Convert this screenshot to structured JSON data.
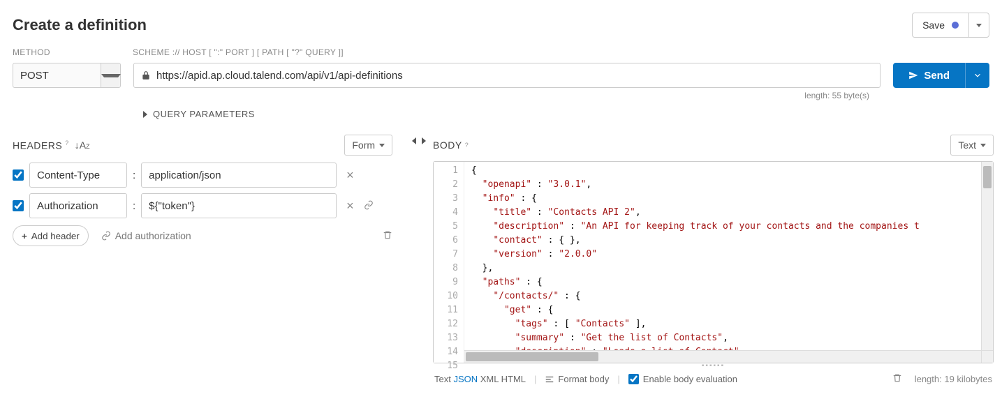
{
  "title": "Create a definition",
  "save": {
    "label": "Save"
  },
  "labels": {
    "method": "METHOD",
    "url": "SCHEME :// HOST [ \":\" PORT ] [ PATH [ \"?\" QUERY ]]"
  },
  "method": "POST",
  "url": "https://apid.ap.cloud.talend.com/api/v1/api-definitions",
  "send": "Send",
  "lengthInfo": "length: 55 byte(s)",
  "queryParams": "QUERY PARAMETERS",
  "headersSection": {
    "title": "HEADERS",
    "mode": "Form"
  },
  "headers": [
    {
      "enabled": true,
      "name": "Content-Type",
      "value": "application/json",
      "hasLink": false
    },
    {
      "enabled": true,
      "name": "Authorization",
      "value": "${\"token\"}",
      "hasLink": true
    }
  ],
  "addHeader": "Add header",
  "addAuth": "Add authorization",
  "bodySection": {
    "title": "BODY",
    "mode": "Text"
  },
  "bodyLineCount": 15,
  "bodyCodeLines": [
    {
      "plain": "{",
      "tokens": [
        {
          "t": "p",
          "v": "{"
        }
      ]
    },
    {
      "plain": "  \"openapi\" : \"3.0.1\",",
      "tokens": [
        {
          "t": "w",
          "v": "  "
        },
        {
          "t": "k",
          "v": "\"openapi\""
        },
        {
          "t": "p",
          "v": " : "
        },
        {
          "t": "s",
          "v": "\"3.0.1\""
        },
        {
          "t": "p",
          "v": ","
        }
      ]
    },
    {
      "plain": "  \"info\" : {",
      "tokens": [
        {
          "t": "w",
          "v": "  "
        },
        {
          "t": "k",
          "v": "\"info\""
        },
        {
          "t": "p",
          "v": " : {"
        }
      ]
    },
    {
      "plain": "    \"title\" : \"Contacts API 2\",",
      "tokens": [
        {
          "t": "w",
          "v": "    "
        },
        {
          "t": "k",
          "v": "\"title\""
        },
        {
          "t": "p",
          "v": " : "
        },
        {
          "t": "s",
          "v": "\"Contacts API 2\""
        },
        {
          "t": "p",
          "v": ","
        }
      ]
    },
    {
      "plain": "    \"description\" : \"An API for keeping track of your contacts and the companies t",
      "tokens": [
        {
          "t": "w",
          "v": "    "
        },
        {
          "t": "k",
          "v": "\"description\""
        },
        {
          "t": "p",
          "v": " : "
        },
        {
          "t": "s",
          "v": "\"An API for keeping track of your contacts and the companies t"
        }
      ]
    },
    {
      "plain": "    \"contact\" : { },",
      "tokens": [
        {
          "t": "w",
          "v": "    "
        },
        {
          "t": "k",
          "v": "\"contact\""
        },
        {
          "t": "p",
          "v": " : { },"
        }
      ]
    },
    {
      "plain": "    \"version\" : \"2.0.0\"",
      "tokens": [
        {
          "t": "w",
          "v": "    "
        },
        {
          "t": "k",
          "v": "\"version\""
        },
        {
          "t": "p",
          "v": " : "
        },
        {
          "t": "s",
          "v": "\"2.0.0\""
        }
      ]
    },
    {
      "plain": "  },",
      "tokens": [
        {
          "t": "w",
          "v": "  "
        },
        {
          "t": "p",
          "v": "},"
        }
      ]
    },
    {
      "plain": "  \"paths\" : {",
      "tokens": [
        {
          "t": "w",
          "v": "  "
        },
        {
          "t": "k",
          "v": "\"paths\""
        },
        {
          "t": "p",
          "v": " : {"
        }
      ]
    },
    {
      "plain": "    \"/contacts/\" : {",
      "tokens": [
        {
          "t": "w",
          "v": "    "
        },
        {
          "t": "k",
          "v": "\"/contacts/\""
        },
        {
          "t": "p",
          "v": " : {"
        }
      ]
    },
    {
      "plain": "      \"get\" : {",
      "tokens": [
        {
          "t": "w",
          "v": "      "
        },
        {
          "t": "k",
          "v": "\"get\""
        },
        {
          "t": "p",
          "v": " : {"
        }
      ]
    },
    {
      "plain": "        \"tags\" : [ \"Contacts\" ],",
      "tokens": [
        {
          "t": "w",
          "v": "        "
        },
        {
          "t": "k",
          "v": "\"tags\""
        },
        {
          "t": "p",
          "v": " : [ "
        },
        {
          "t": "s",
          "v": "\"Contacts\""
        },
        {
          "t": "p",
          "v": " ],"
        }
      ]
    },
    {
      "plain": "        \"summary\" : \"Get the list of Contacts\",",
      "tokens": [
        {
          "t": "w",
          "v": "        "
        },
        {
          "t": "k",
          "v": "\"summary\""
        },
        {
          "t": "p",
          "v": " : "
        },
        {
          "t": "s",
          "v": "\"Get the list of Contacts\""
        },
        {
          "t": "p",
          "v": ","
        }
      ]
    },
    {
      "plain": "        \"description\" : \"Loads a list of Contact\",",
      "tokens": [
        {
          "t": "w",
          "v": "        "
        },
        {
          "t": "k",
          "v": "\"description\""
        },
        {
          "t": "p",
          "v": " : "
        },
        {
          "t": "s",
          "v": "\"Loads a list of Contact\""
        },
        {
          "t": "p",
          "v": ","
        }
      ]
    },
    {
      "plain": "",
      "tokens": []
    }
  ],
  "bodyFooter": {
    "modes": [
      "Text",
      "JSON",
      "XML",
      "HTML"
    ],
    "activeMode": "JSON",
    "formatBody": "Format body",
    "enableEval": "Enable body evaluation",
    "enableEvalChecked": true,
    "length": "length: 19 kilobytes"
  }
}
